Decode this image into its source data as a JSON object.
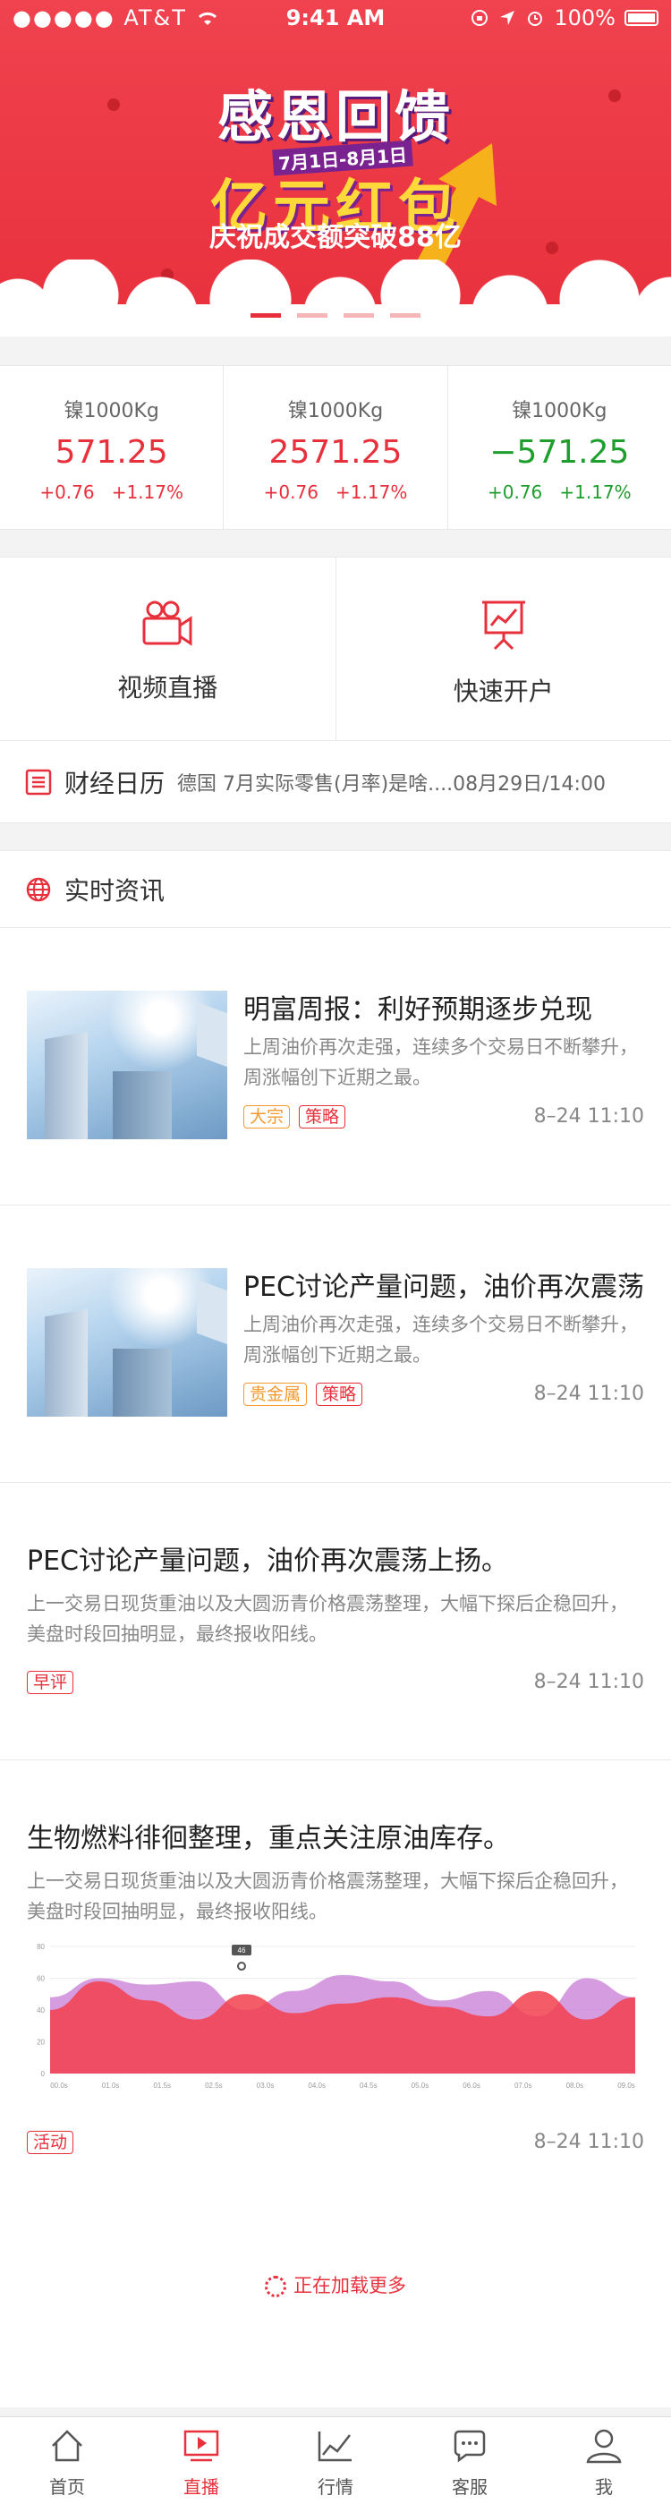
{
  "status_bar": {
    "carrier": "●●●●● AT&T",
    "time": "9:41 AM",
    "battery": "100%"
  },
  "banner": {
    "title": "感恩回馈",
    "date_range": "7月1日-8月1日",
    "headline": "亿元红包",
    "subtitle": "庆祝成交额突破88亿",
    "pages": 4,
    "active_page": 0
  },
  "quotes": [
    {
      "name": "镍1000Kg",
      "price": "571.25",
      "change": "+0.76",
      "percent": "+1.17%",
      "trend": "up"
    },
    {
      "name": "镍1000Kg",
      "price": "2571.25",
      "change": "+0.76",
      "percent": "+1.17%",
      "trend": "up"
    },
    {
      "name": "镍1000Kg",
      "price": "−571.25",
      "change": "+0.76",
      "percent": "+1.17%",
      "trend": "down"
    }
  ],
  "features": [
    {
      "label": "视频直播",
      "icon": "video-camera-icon"
    },
    {
      "label": "快速开户",
      "icon": "presentation-board-icon"
    }
  ],
  "calendar": {
    "title": "财经日历",
    "ticker": "德国 7月实际零售(月率)是啥....08月29日/14:00",
    "icon": "list-doc-icon"
  },
  "news": {
    "title": "实时资讯",
    "icon": "globe-icon",
    "items": [
      {
        "title": "明富周报：利好预期逐步兑现",
        "desc": "上周油价再次走强，连续多个交易日不断攀升，周涨幅创下近期之最。",
        "tags": [
          "大宗",
          "策略"
        ],
        "time": "8–24  11:10"
      },
      {
        "title": "PEC讨论产量问题，油价再次震荡",
        "desc": "上周油价再次走强，连续多个交易日不断攀升，周涨幅创下近期之最。",
        "tags": [
          "贵金属",
          "策略"
        ],
        "time": "8–24  11:10"
      },
      {
        "title": "PEC讨论产量问题，油价再次震荡上扬。",
        "desc": "上一交易日现货重油以及大圆沥青价格震荡整理，大幅下探后企稳回升，美盘时段回抽明显，最终报收阳线。",
        "tags": [
          "早评"
        ],
        "time": "8–24  11:10"
      },
      {
        "title": "生物燃料徘徊整理，重点关注原油库存。",
        "desc": "上一交易日现货重油以及大圆沥青价格震荡整理，大幅下探后企稳回升，美盘时段回抽明显，最终报收阳线。",
        "tags": [
          "活动"
        ],
        "time": "8–24  11:10"
      }
    ]
  },
  "chart_data": {
    "type": "area",
    "x": [
      "00.0s",
      "01.0s",
      "01.5s",
      "02.5s",
      "03.0s",
      "04.0s",
      "04.5s",
      "05.0s",
      "06.0s",
      "07.0s",
      "08.0s",
      "09.0s"
    ],
    "yticks": [
      0,
      20,
      40,
      60,
      80
    ],
    "ylim": [
      0,
      80
    ],
    "marker_label": "46",
    "series": [
      {
        "values": [
          48,
          60,
          56,
          58,
          40,
          52,
          62,
          58,
          46,
          52,
          36,
          60,
          48
        ],
        "color": "#c77bd6"
      },
      {
        "values": [
          40,
          58,
          46,
          34,
          50,
          38,
          44,
          48,
          42,
          36,
          52,
          34,
          48
        ],
        "color": "#f2404d"
      }
    ],
    "grid": true,
    "legend": "none"
  },
  "loading_text": "正在加载更多",
  "tabbar": [
    {
      "label": "首页",
      "icon": "home-icon",
      "active": false
    },
    {
      "label": "直播",
      "icon": "play-screen-icon",
      "active": true
    },
    {
      "label": "行情",
      "icon": "trend-chart-icon",
      "active": false
    },
    {
      "label": "客服",
      "icon": "chat-bubble-icon",
      "active": false
    },
    {
      "label": "我",
      "icon": "user-icon",
      "active": false
    }
  ]
}
